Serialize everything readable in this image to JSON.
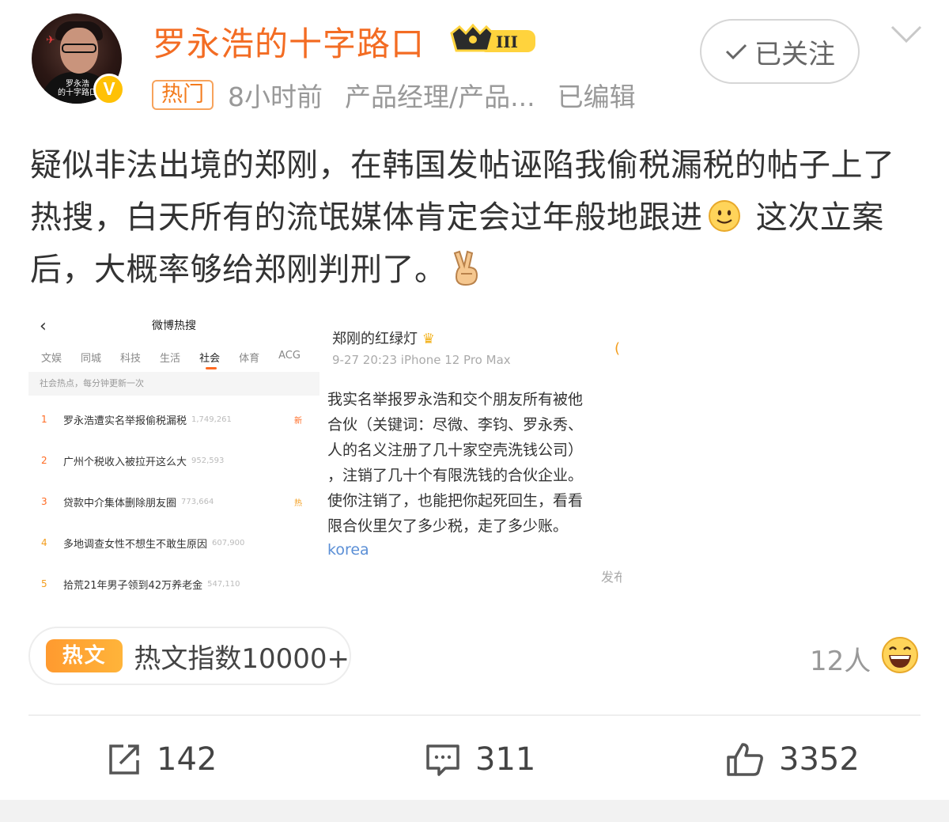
{
  "author": {
    "name": "罗永浩的十字路口",
    "avatar_caption": "罗永浩\n的十字路口",
    "verified_badge": "V",
    "rank_badge": "III",
    "follow_label": "已关注"
  },
  "meta": {
    "hot_tag": "热门",
    "time": "8小时前",
    "source": "产品经理/产品...",
    "edited": "已编辑"
  },
  "post": {
    "text_part1": "疑似非法出境的郑刚，在韩国发帖诬陷我偷税漏税的帖子上了热搜，白天所有的流氓媒体肯定会过年般地跟进",
    "text_part2": " 这次立案后，大概率够给郑刚判刑了。"
  },
  "image1": {
    "back_icon": "‹",
    "title": "微博热搜",
    "tabs": [
      "文娱",
      "同城",
      "科技",
      "生活",
      "社会",
      "体育",
      "ACG"
    ],
    "active_tab": "社会",
    "subtitle": "社会热点，每分钟更新一次",
    "rows": [
      {
        "rank": "1",
        "title": "罗永浩遭实名举报偷税漏税",
        "heat": "1,749,261",
        "tag": "新"
      },
      {
        "rank": "2",
        "title": "广州个税收入被拉开这么大",
        "heat": "952,593",
        "tag": ""
      },
      {
        "rank": "3",
        "title": "贷款中介集体删除朋友圈",
        "heat": "773,664",
        "tag": "热"
      },
      {
        "rank": "4",
        "title": "多地调查女性不想生不敢生原因",
        "heat": "607,900",
        "tag": ""
      },
      {
        "rank": "5",
        "title": "拾荒21年男子领到42万养老金",
        "heat": "547,110",
        "tag": ""
      }
    ]
  },
  "image2": {
    "name": "郑刚的红绿灯",
    "time_device": "9-27 20:23   iPhone 12 Pro Max",
    "lines": [
      "我实名举报罗永浩和交个朋友所有被他",
      "合伙（关键词：尽微、李钧、罗永秀、",
      "人的名义注册了几十家空壳洗钱公司）",
      "，注销了几十个有限洗钱的合伙企业。",
      "使你注销了，也能把你起死回生，看看",
      "限合伙里欠了多少税，走了多少账。"
    ],
    "link": "korea",
    "footer": "发布"
  },
  "hot_article": {
    "badge": "热文",
    "value": "热文指数10000+"
  },
  "reactions": {
    "count": "12人"
  },
  "actions": {
    "repost": "142",
    "comment": "311",
    "like": "3352"
  },
  "colors": {
    "author": "#f36c23",
    "accent": "#ff6a22",
    "meta": "#999999",
    "verified": "#ffc106"
  }
}
